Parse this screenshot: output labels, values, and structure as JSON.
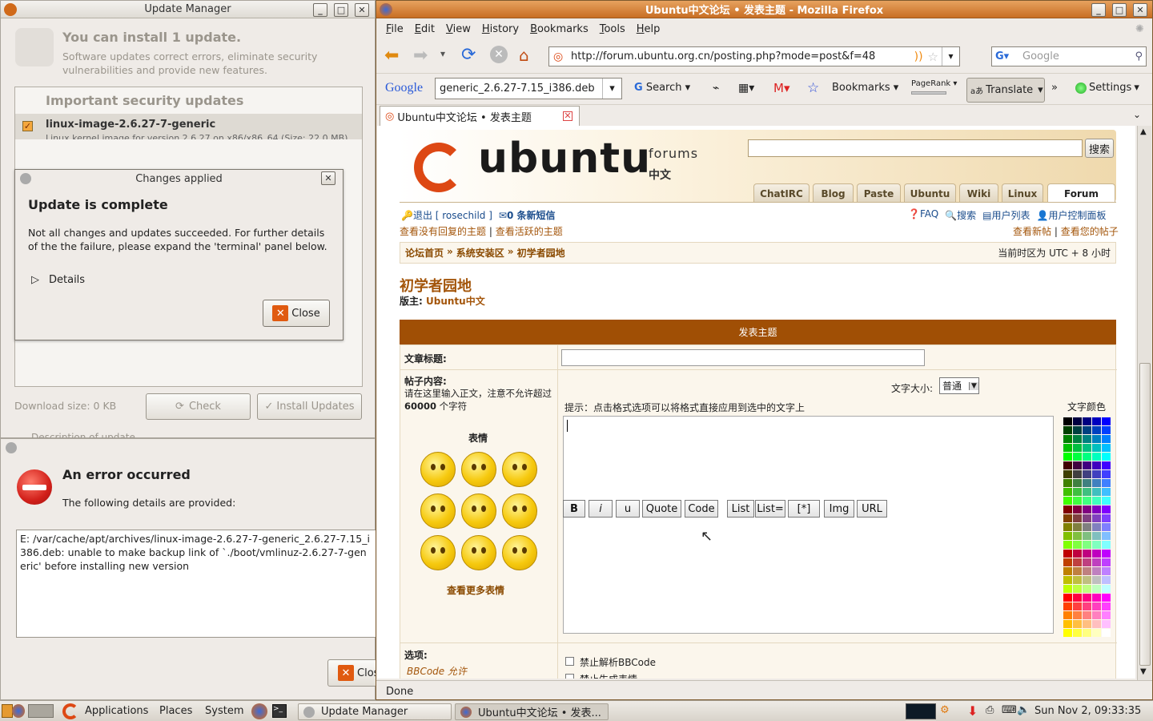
{
  "update_manager": {
    "title": "Update Manager",
    "headline": "You can install 1 update.",
    "subtext": "Software updates correct errors, eliminate security vulnerabilities and provide new features.",
    "section_title": "Important security updates",
    "package_name": "linux-image-2.6.27-7-generic",
    "package_desc": "Linux kernel image for version 2.6.27 on x86/x86_64 (Size: 22.0 MB)",
    "download_size": "Download size: 0 KB",
    "check_label": "Check",
    "install_label": "Install Updates",
    "desc_expander": "Description of update"
  },
  "changes_applied": {
    "title": "Changes applied",
    "heading": "Update is complete",
    "body": "Not all changes and updates succeeded. For further details of the the failure, please expand the 'terminal' panel below.",
    "details_label": "Details",
    "close_label": "Close"
  },
  "error_dialog": {
    "heading": "An error occurred",
    "subheading": "The following details are provided:",
    "details": "E: /var/cache/apt/archives/linux-image-2.6.27-7-generic_2.6.27-7.15_i386.deb: unable to make backup link of `./boot/vmlinuz-2.6.27-7-generic' before installing new version",
    "close_label": "Clos"
  },
  "firefox": {
    "title": "Ubuntu中文论坛 • 发表主题 - Mozilla Firefox",
    "menu": [
      "File",
      "Edit",
      "View",
      "History",
      "Bookmarks",
      "Tools",
      "Help"
    ],
    "url": "http://forum.ubuntu.org.cn/posting.php?mode=post&f=48",
    "search_placeholder": "Google",
    "google_toolbar": {
      "query": "generic_2.6.27-7.15_i386.deb",
      "search_label": "Search",
      "bookmarks_label": "Bookmarks",
      "pagerank_label": "PageRank",
      "translate_label": "Translate",
      "settings_label": "Settings"
    },
    "tab_title": "Ubuntu中文论坛 • 发表主题",
    "status": "Done"
  },
  "forum": {
    "logo_text": "ubuntu",
    "logo_sub1": "forums",
    "logo_sub2": "中文",
    "search_button": "搜索",
    "nav_tabs": [
      "ChatIRC",
      "Blog",
      "Paste",
      "Ubuntu",
      "Wiki",
      "Linux",
      "Forum"
    ],
    "logout": "退出 [ rosechild ]",
    "pm": "0 条新短信",
    "faq": "FAQ",
    "search_link": "搜索",
    "members": "用户列表",
    "ucp": "用户控制面板",
    "unanswered": "查看没有回复的主题",
    "active": "查看活跃的主题",
    "new_posts": "查看新帖",
    "your_posts": "查看您的帖子",
    "breadcrumb": [
      "论坛首页",
      "系统安装区",
      "初学者园地"
    ],
    "breadcrumb_sep": "»",
    "timezone": "当前时区为 UTC + 8 小时",
    "forum_title": "初学者园地",
    "moderator_label": "版主:",
    "moderator": "Ubuntu中文",
    "post_header": "发表主题",
    "subject_label": "文章标题:",
    "body_label": "帖子内容:",
    "body_hint": "请在这里输入正文，注意不允许超过",
    "body_limit": "60000",
    "body_limit_suffix": "个字符",
    "smilies_label": "表情",
    "more_smilies": "查看更多表情",
    "format_buttons": [
      "B",
      "i",
      "u",
      "Quote",
      "Code",
      "List",
      "List=",
      "[*]",
      "Img",
      "URL"
    ],
    "font_size_label": "文字大小:",
    "font_size_value": "普通",
    "color_label": "文字颜色",
    "format_hint": "提示：点击格式选项可以将格式直接应用到选中的文字上",
    "options_label": "选项:",
    "bbcode_status": "BBCode 允许",
    "opt_disable_bbcode": "禁止解析BBCode",
    "opt_disable_smilies": "禁止生成表情"
  },
  "taskbar": {
    "applications": "Applications",
    "places": "Places",
    "system": "System",
    "task1": "Update Manager",
    "task2": "Ubuntu中文论坛 • 发表...",
    "clock": "Sun Nov  2, 09:33:35"
  },
  "colors": {
    "forum_header": "#a04f05",
    "ubuntu_orange": "#dd4814",
    "firefox_title": "#d07a2f"
  }
}
